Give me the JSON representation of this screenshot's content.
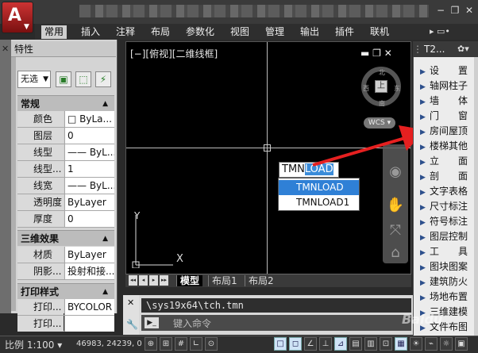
{
  "app": {
    "logo": "A"
  },
  "window": {
    "minimize": "−",
    "restore": "❐",
    "close": "✕"
  },
  "ribbon": {
    "tabs": [
      {
        "label": "常用",
        "active": true
      },
      {
        "label": "插入"
      },
      {
        "label": "注释"
      },
      {
        "label": "布局"
      },
      {
        "label": "参数化"
      },
      {
        "label": "视图"
      },
      {
        "label": "管理"
      },
      {
        "label": "输出"
      },
      {
        "label": "插件"
      },
      {
        "label": "联机"
      }
    ],
    "extra": "▸ ▭•"
  },
  "properties": {
    "title": "特性",
    "selection": "无选",
    "sections": [
      {
        "title": "常规",
        "rows": [
          {
            "key": "颜色",
            "value": "□ ByLa..."
          },
          {
            "key": "图层",
            "value": "0"
          },
          {
            "key": "线型",
            "value": "—— ByL..."
          },
          {
            "key": "线型...",
            "value": "1"
          },
          {
            "key": "线宽",
            "value": "—— ByL..."
          },
          {
            "key": "透明度",
            "value": "ByLayer"
          },
          {
            "key": "厚度",
            "value": "0"
          }
        ]
      },
      {
        "title": "三维效果",
        "rows": [
          {
            "key": "材质",
            "value": "ByLayer"
          },
          {
            "key": "阴影...",
            "value": "投射和接..."
          }
        ]
      },
      {
        "title": "打印样式",
        "rows": [
          {
            "key": "打印...",
            "value": "BYCOLOR"
          },
          {
            "key": "打印...",
            "value": ""
          }
        ]
      }
    ]
  },
  "viewport": {
    "label": "[−][俯视][二维线框]",
    "tools": "▬  ❐  ✕",
    "viewcube_face": "上",
    "compass": {
      "n": "北",
      "s": "南",
      "e": "东",
      "w": "西"
    },
    "wcs": "WCS ▾"
  },
  "command_popup": {
    "typed": "TMN",
    "highlighted": "LOAD",
    "suggestions": [
      "TMNLOAD",
      "TMNLOAD1"
    ]
  },
  "layout_tabs": {
    "nav": [
      "◂◂",
      "◂",
      "▸",
      "▸▸"
    ],
    "tabs": [
      {
        "label": "模型",
        "active": true
      },
      {
        "label": "布局1"
      },
      {
        "label": "布局2"
      }
    ]
  },
  "command_line": {
    "history": "\\sys19x64\\tch.tmn",
    "prompt": "键入命令",
    "prompt_icon": "▶_"
  },
  "statusbar": {
    "scale": "比例 1:100 ▾",
    "coords": "46983, 24239, 0"
  },
  "tangent": {
    "title": "T2...",
    "items": [
      "设　　置",
      "轴网柱子",
      "墙　　体",
      "门　　窗",
      "房间屋顶",
      "楼梯其他",
      "立　　面",
      "剖　　面",
      "文字表格",
      "尺寸标注",
      "符号标注",
      "图层控制",
      "工　　具",
      "图块图案",
      "建筑防火",
      "场地布置",
      "三维建模",
      "文件布图"
    ]
  },
  "watermark": "Baidu"
}
